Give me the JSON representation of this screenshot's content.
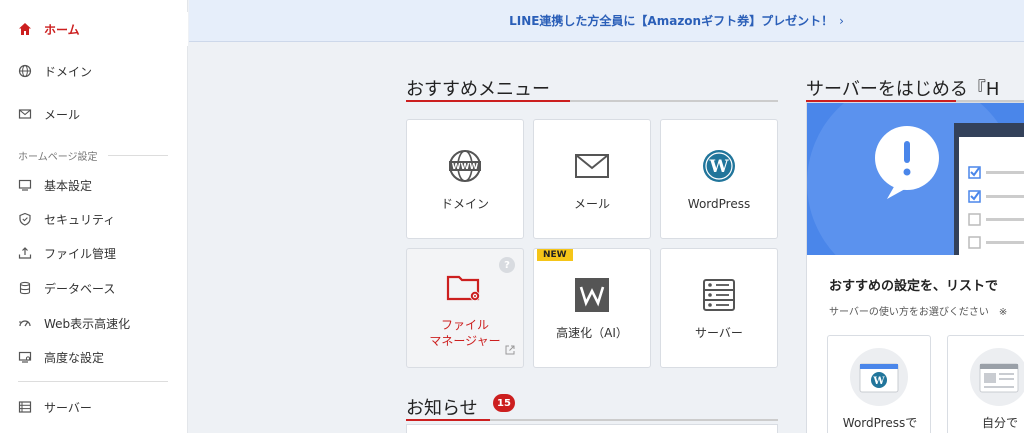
{
  "sidebar": {
    "items": [
      {
        "label": "ホーム",
        "icon": "home-icon"
      },
      {
        "label": "ドメイン",
        "icon": "globe-icon"
      },
      {
        "label": "メール",
        "icon": "mail-icon"
      }
    ],
    "section_label": "ホームページ設定",
    "section_items": [
      {
        "label": "基本設定",
        "icon": "monitor-icon"
      },
      {
        "label": "セキュリティ",
        "icon": "shield-icon"
      },
      {
        "label": "ファイル管理",
        "icon": "upload-icon"
      },
      {
        "label": "データベース",
        "icon": "database-icon"
      },
      {
        "label": "Web表示高速化",
        "icon": "speed-icon"
      },
      {
        "label": "高度な設定",
        "icon": "advanced-monitor-icon"
      }
    ],
    "bottom_items": [
      {
        "label": "サーバー",
        "icon": "server-icon"
      }
    ]
  },
  "banner": {
    "text": "LINE連携した方全員に【Amazonギフト券】プレゼント！",
    "chevron": "›"
  },
  "recommended": {
    "title": "おすすめメニュー",
    "cards": [
      {
        "label": "ドメイン",
        "icon": "www-globe-icon"
      },
      {
        "label": "メール",
        "icon": "envelope-icon"
      },
      {
        "label": "WordPress",
        "icon": "wordpress-icon"
      },
      {
        "label_line1": "ファイル",
        "label_line2": "マネージャー",
        "icon": "folder-gear-icon",
        "help": "?"
      },
      {
        "label": "高速化（AI）",
        "icon": "w-logo-icon",
        "badge": "NEW"
      },
      {
        "label": "サーバー",
        "icon": "server-rack-icon"
      }
    ]
  },
  "news": {
    "title": "お知らせ",
    "count": "15"
  },
  "right_panel": {
    "title": "サーバーをはじめる『H",
    "heading": "おすすめの設定を、リストで",
    "sub": "サーバーの使い方をお選びください　※",
    "options": [
      {
        "label": "WordPressで"
      },
      {
        "label": "自分で"
      }
    ]
  },
  "colors": {
    "accent": "#cc1f1f",
    "banner_text": "#2b5fb8",
    "hero_blue": "#4a86ea",
    "new_badge": "#f5c518"
  }
}
